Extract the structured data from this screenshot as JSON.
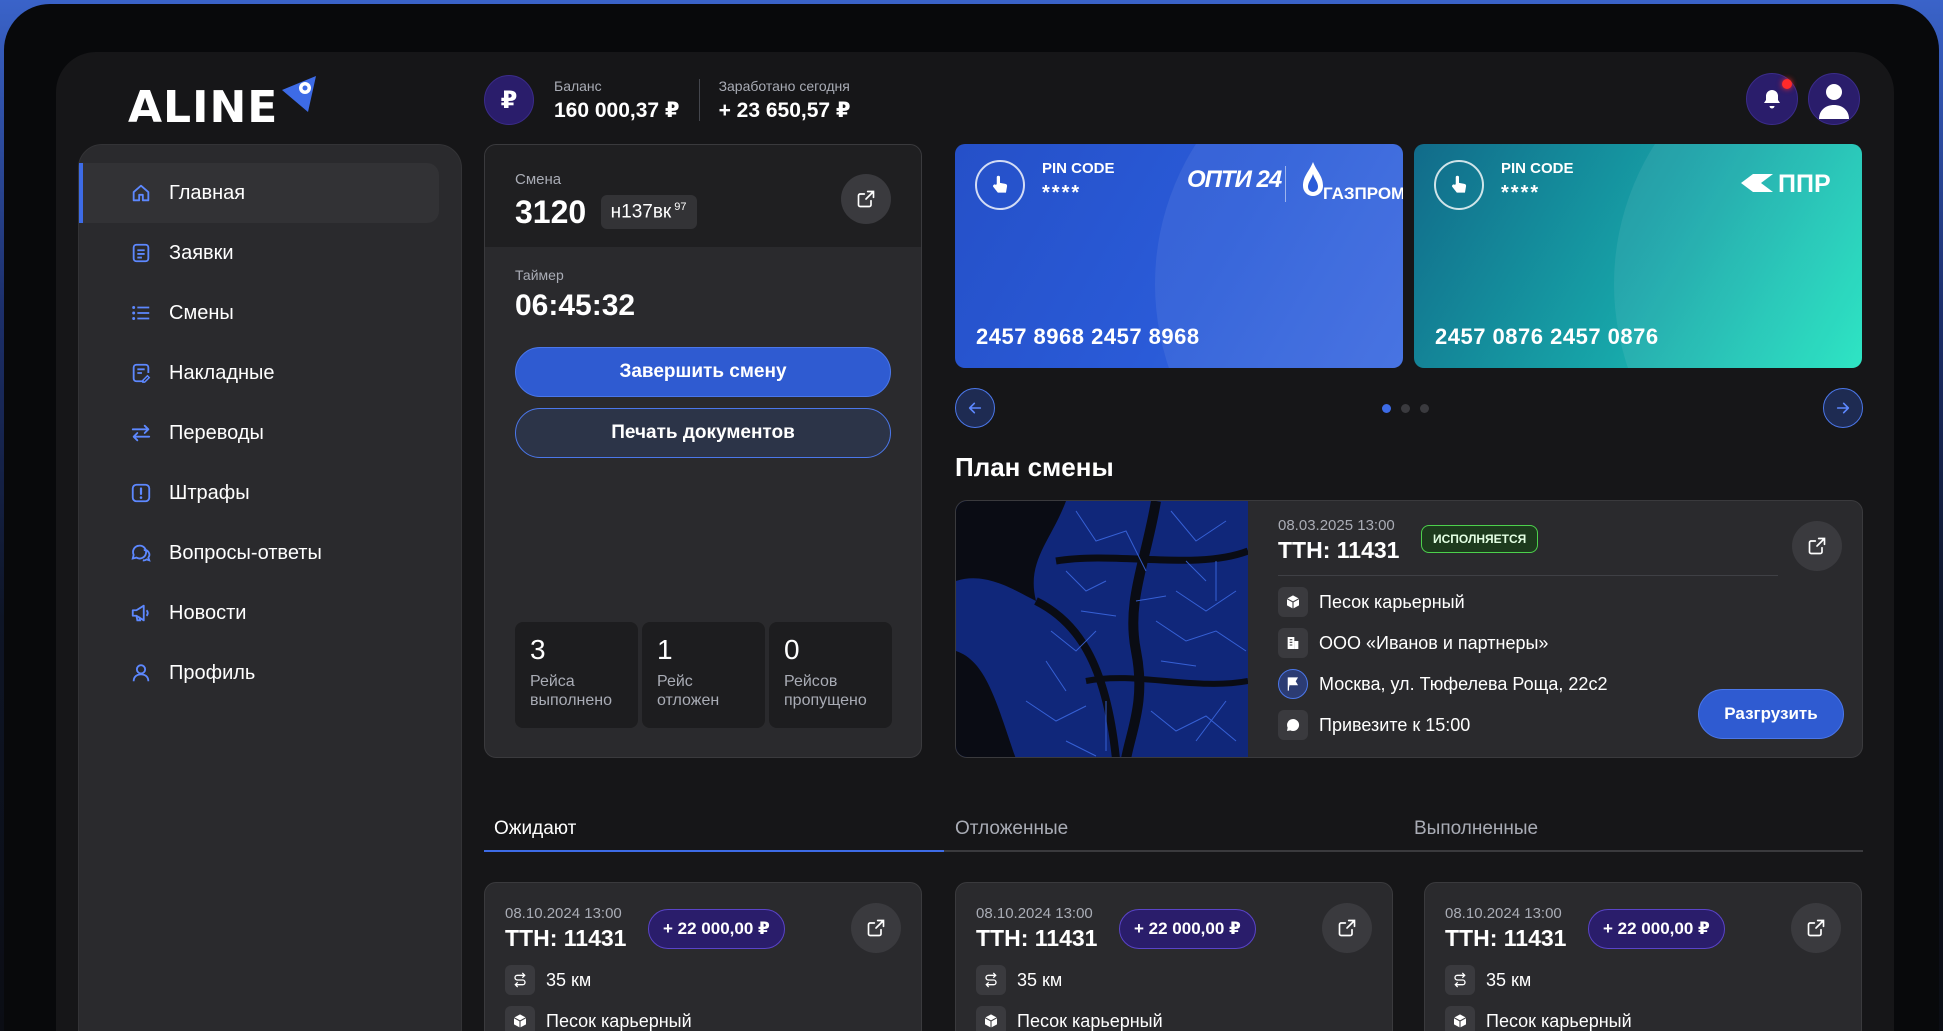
{
  "app": {
    "logo": "ALINE"
  },
  "header": {
    "currency_symbol": "₽",
    "balance_label": "Баланс",
    "balance_value": "160 000,37 ₽",
    "earned_label": "Заработано сегодня",
    "earned_value": "+ 23 650,57 ₽"
  },
  "sidebar": {
    "items": [
      {
        "label": "Главная",
        "icon": "home-icon",
        "active": true
      },
      {
        "label": "Заявки",
        "icon": "document-icon"
      },
      {
        "label": "Смены",
        "icon": "list-icon"
      },
      {
        "label": "Накладные",
        "icon": "invoice-icon"
      },
      {
        "label": "Переводы",
        "icon": "transfer-icon"
      },
      {
        "label": "Штрафы",
        "icon": "alert-icon"
      },
      {
        "label": "Вопросы-ответы",
        "icon": "chat-question-icon"
      },
      {
        "label": "Новости",
        "icon": "megaphone-icon"
      },
      {
        "label": "Профиль",
        "icon": "user-icon"
      }
    ]
  },
  "shift": {
    "label": "Смена",
    "number": "3120",
    "plate": "н137вк",
    "plate_region": "97",
    "timer_label": "Таймер",
    "timer_value": "06:45:32",
    "finish_button": "Завершить смену",
    "print_button": "Печать документов",
    "stats": [
      {
        "value": "3",
        "label": "Рейса выполнено"
      },
      {
        "value": "1",
        "label": "Рейс отложен"
      },
      {
        "value": "0",
        "label": "Рейсов пропущено"
      }
    ]
  },
  "fuel_cards": [
    {
      "pin_label": "PIN CODE",
      "pin": "****",
      "number": "2457 8968 2457 8968",
      "brand_1": "ОПТИ 24",
      "brand_2": "ГАЗПРОМ",
      "color": "#2a5bd8"
    },
    {
      "pin_label": "PIN CODE",
      "pin": "****",
      "number": "2457 0876 2457 0876",
      "brand_1": "ППР",
      "color": "#17a6a9"
    }
  ],
  "carousel": {
    "active_index": 0,
    "total": 3
  },
  "plan": {
    "title": "План смены",
    "date": "08.03.2025 13:00",
    "ttn": "ТТН: 11431",
    "status": "ИСПОЛНЯЕТСЯ",
    "cargo": "Песок карьерный",
    "company": "ООО «Иванов и партнеры»",
    "address": "Москва, ул. Тюфелева Роща, 22с2",
    "note": "Привезите к 15:00",
    "unload_button": "Разгрузить"
  },
  "tabs": [
    {
      "label": "Ожидают",
      "active": true
    },
    {
      "label": "Отложенные"
    },
    {
      "label": "Выполненные"
    }
  ],
  "orders": [
    {
      "date": "08.10.2024 13:00",
      "ttn": "ТТН: 11431",
      "sum": "+ 22 000,00 ₽",
      "distance": "35 км",
      "cargo": "Песок карьерный"
    },
    {
      "date": "08.10.2024 13:00",
      "ttn": "ТТН: 11431",
      "sum": "+ 22 000,00 ₽",
      "distance": "35 км",
      "cargo": "Песок карьерный"
    },
    {
      "date": "08.10.2024 13:00",
      "ttn": "ТТН: 11431",
      "sum": "+ 22 000,00 ₽",
      "distance": "35 км",
      "cargo": "Песок карьерный"
    }
  ]
}
